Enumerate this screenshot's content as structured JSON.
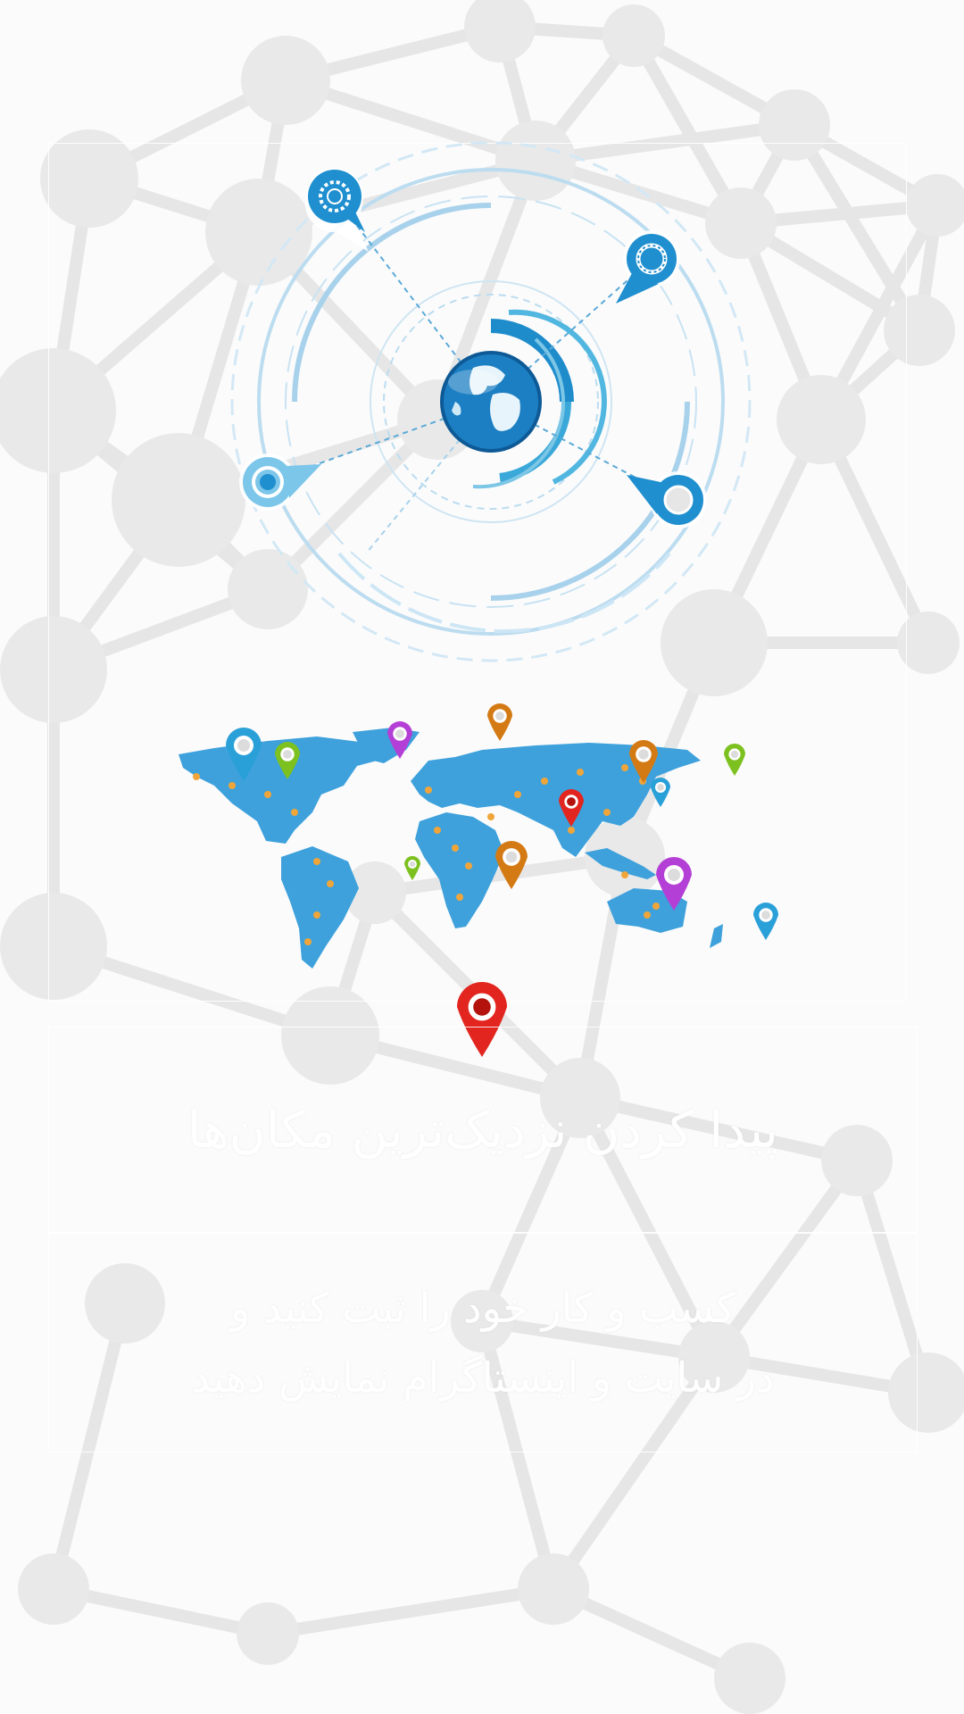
{
  "screen": {
    "background_color": "#fbfbfb",
    "network_color": "#e6e6e6",
    "node_color": "#e9e9e9"
  },
  "onboarding": {
    "title": "پیدا کردن نزدیک‌ترین مکان‌ها",
    "description_line1": "کسب و کار خود را ثبت کنید و",
    "description_line2": "در سایت و اینستاگرام نمایش دهید"
  },
  "hub": {
    "accent_color": "#1e8ccb",
    "ring_color": "#b7d9ee",
    "icons": [
      "swirl-pin-icon",
      "ring-pin-icon",
      "target-pin-icon",
      "dot-pin-icon"
    ]
  },
  "map": {
    "land_color": "#3ea1dc",
    "dot_color": "#f0a53a",
    "pin_colors": {
      "blue": "#2aa0d8",
      "green": "#7cc11f",
      "purple": "#b43fd6",
      "orange": "#d47a14",
      "red": "#e2261f"
    }
  }
}
